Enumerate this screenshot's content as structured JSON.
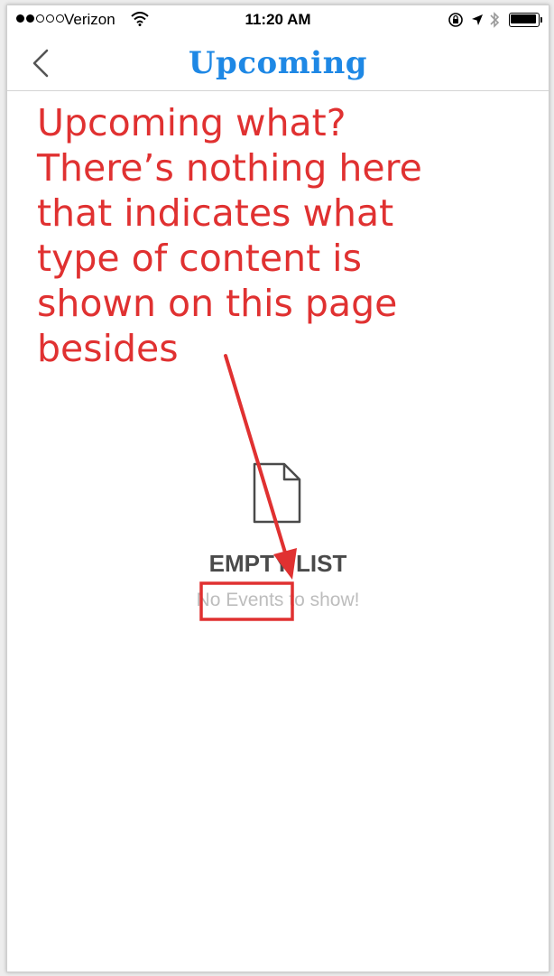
{
  "status_bar": {
    "carrier": "Verizon",
    "time": "11:20 AM",
    "signal_bars_filled": 2,
    "signal_bars_total": 5,
    "battery_level": 1.0,
    "icons": [
      "wifi-icon",
      "orientation-lock-icon",
      "location-arrow-icon",
      "bluetooth-icon",
      "battery-icon"
    ]
  },
  "nav": {
    "title": "Upcoming",
    "back_icon": "chevron-left-icon"
  },
  "empty_state": {
    "icon": "document-icon",
    "title": "EMPTY LIST",
    "subtitle": "No Events to show!"
  },
  "annotation": {
    "text": "Upcoming what?\nThere’s nothing here\nthat indicates what\ntype of content is\nshown on this page\nbesides",
    "color": "#e03131"
  },
  "colors": {
    "title_blue": "#1e88e5",
    "annotation_red": "#e03131"
  }
}
